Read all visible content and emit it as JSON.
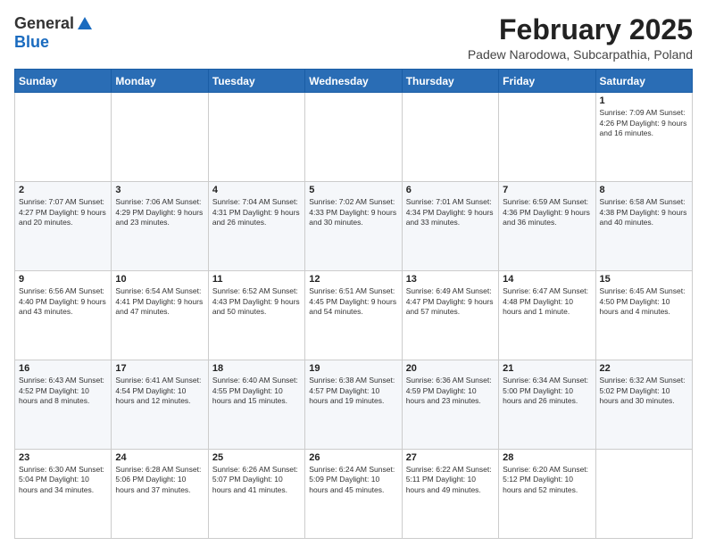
{
  "logo": {
    "general": "General",
    "blue": "Blue"
  },
  "title": "February 2025",
  "location": "Padew Narodowa, Subcarpathia, Poland",
  "days_of_week": [
    "Sunday",
    "Monday",
    "Tuesday",
    "Wednesday",
    "Thursday",
    "Friday",
    "Saturday"
  ],
  "weeks": [
    [
      {
        "day": "",
        "info": ""
      },
      {
        "day": "",
        "info": ""
      },
      {
        "day": "",
        "info": ""
      },
      {
        "day": "",
        "info": ""
      },
      {
        "day": "",
        "info": ""
      },
      {
        "day": "",
        "info": ""
      },
      {
        "day": "1",
        "info": "Sunrise: 7:09 AM\nSunset: 4:26 PM\nDaylight: 9 hours and 16 minutes."
      }
    ],
    [
      {
        "day": "2",
        "info": "Sunrise: 7:07 AM\nSunset: 4:27 PM\nDaylight: 9 hours and 20 minutes."
      },
      {
        "day": "3",
        "info": "Sunrise: 7:06 AM\nSunset: 4:29 PM\nDaylight: 9 hours and 23 minutes."
      },
      {
        "day": "4",
        "info": "Sunrise: 7:04 AM\nSunset: 4:31 PM\nDaylight: 9 hours and 26 minutes."
      },
      {
        "day": "5",
        "info": "Sunrise: 7:02 AM\nSunset: 4:33 PM\nDaylight: 9 hours and 30 minutes."
      },
      {
        "day": "6",
        "info": "Sunrise: 7:01 AM\nSunset: 4:34 PM\nDaylight: 9 hours and 33 minutes."
      },
      {
        "day": "7",
        "info": "Sunrise: 6:59 AM\nSunset: 4:36 PM\nDaylight: 9 hours and 36 minutes."
      },
      {
        "day": "8",
        "info": "Sunrise: 6:58 AM\nSunset: 4:38 PM\nDaylight: 9 hours and 40 minutes."
      }
    ],
    [
      {
        "day": "9",
        "info": "Sunrise: 6:56 AM\nSunset: 4:40 PM\nDaylight: 9 hours and 43 minutes."
      },
      {
        "day": "10",
        "info": "Sunrise: 6:54 AM\nSunset: 4:41 PM\nDaylight: 9 hours and 47 minutes."
      },
      {
        "day": "11",
        "info": "Sunrise: 6:52 AM\nSunset: 4:43 PM\nDaylight: 9 hours and 50 minutes."
      },
      {
        "day": "12",
        "info": "Sunrise: 6:51 AM\nSunset: 4:45 PM\nDaylight: 9 hours and 54 minutes."
      },
      {
        "day": "13",
        "info": "Sunrise: 6:49 AM\nSunset: 4:47 PM\nDaylight: 9 hours and 57 minutes."
      },
      {
        "day": "14",
        "info": "Sunrise: 6:47 AM\nSunset: 4:48 PM\nDaylight: 10 hours and 1 minute."
      },
      {
        "day": "15",
        "info": "Sunrise: 6:45 AM\nSunset: 4:50 PM\nDaylight: 10 hours and 4 minutes."
      }
    ],
    [
      {
        "day": "16",
        "info": "Sunrise: 6:43 AM\nSunset: 4:52 PM\nDaylight: 10 hours and 8 minutes."
      },
      {
        "day": "17",
        "info": "Sunrise: 6:41 AM\nSunset: 4:54 PM\nDaylight: 10 hours and 12 minutes."
      },
      {
        "day": "18",
        "info": "Sunrise: 6:40 AM\nSunset: 4:55 PM\nDaylight: 10 hours and 15 minutes."
      },
      {
        "day": "19",
        "info": "Sunrise: 6:38 AM\nSunset: 4:57 PM\nDaylight: 10 hours and 19 minutes."
      },
      {
        "day": "20",
        "info": "Sunrise: 6:36 AM\nSunset: 4:59 PM\nDaylight: 10 hours and 23 minutes."
      },
      {
        "day": "21",
        "info": "Sunrise: 6:34 AM\nSunset: 5:00 PM\nDaylight: 10 hours and 26 minutes."
      },
      {
        "day": "22",
        "info": "Sunrise: 6:32 AM\nSunset: 5:02 PM\nDaylight: 10 hours and 30 minutes."
      }
    ],
    [
      {
        "day": "23",
        "info": "Sunrise: 6:30 AM\nSunset: 5:04 PM\nDaylight: 10 hours and 34 minutes."
      },
      {
        "day": "24",
        "info": "Sunrise: 6:28 AM\nSunset: 5:06 PM\nDaylight: 10 hours and 37 minutes."
      },
      {
        "day": "25",
        "info": "Sunrise: 6:26 AM\nSunset: 5:07 PM\nDaylight: 10 hours and 41 minutes."
      },
      {
        "day": "26",
        "info": "Sunrise: 6:24 AM\nSunset: 5:09 PM\nDaylight: 10 hours and 45 minutes."
      },
      {
        "day": "27",
        "info": "Sunrise: 6:22 AM\nSunset: 5:11 PM\nDaylight: 10 hours and 49 minutes."
      },
      {
        "day": "28",
        "info": "Sunrise: 6:20 AM\nSunset: 5:12 PM\nDaylight: 10 hours and 52 minutes."
      },
      {
        "day": "",
        "info": ""
      }
    ]
  ]
}
